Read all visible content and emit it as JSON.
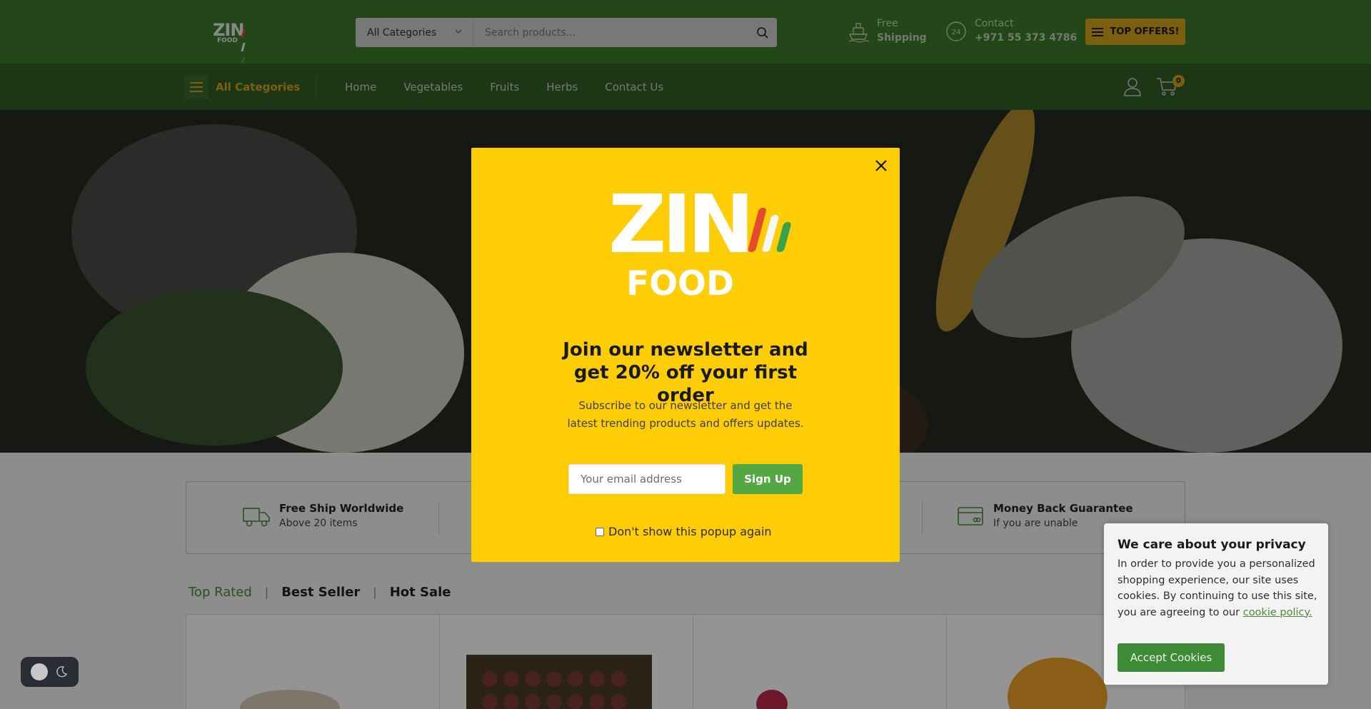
{
  "colors": {
    "header_green": "#3f7a2e",
    "nav_green": "#335e26",
    "accent_yellow": "#d4a419",
    "popup_yellow": "#ffcd05",
    "signup_green": "#54a844"
  },
  "header": {
    "logo_text": "ZIN",
    "logo_sub": "FOOD",
    "search": {
      "category": "All Categories",
      "placeholder": "Search products..."
    },
    "shipping": {
      "line1": "Free",
      "line2": "Shipping",
      "icon": "ship-icon"
    },
    "contact": {
      "line1": "Contact",
      "line2": "+971 55 373 4786",
      "icon": "support-24-icon"
    },
    "top_offers": "TOP OFFERS!"
  },
  "nav": {
    "all_categories": "All Categories",
    "links": [
      "Home",
      "Vegetables",
      "Fruits",
      "Herbs",
      "Contact Us"
    ],
    "cart_count": "0"
  },
  "features": [
    {
      "title": "Free Ship Worldwide",
      "sub": "Above 20 items",
      "icon": "truck-icon"
    },
    {
      "title": "Money Back Guarantee",
      "sub": "If you are unable",
      "icon": "credit-card-icon"
    }
  ],
  "tabs": [
    "Top Rated",
    "Best Seller",
    "Hot Sale"
  ],
  "popup": {
    "logo_text": "ZIN",
    "logo_sub": "FOOD",
    "title": "Join our newsletter and get 20% off your first order",
    "subtitle": "Subscribe to our newsletter and get the latest trending products and offers updates.",
    "email_placeholder": "Your email address",
    "signup": "Sign Up",
    "dont_show": "Don't show this popup again"
  },
  "cookie": {
    "title": "We care about your privacy",
    "body": "In order to provide you a personalized shopping experience, our site uses cookies. By continuing to use this site, you are agreeing to our ",
    "link": "cookie policy.",
    "accept": "Accept Cookies"
  }
}
